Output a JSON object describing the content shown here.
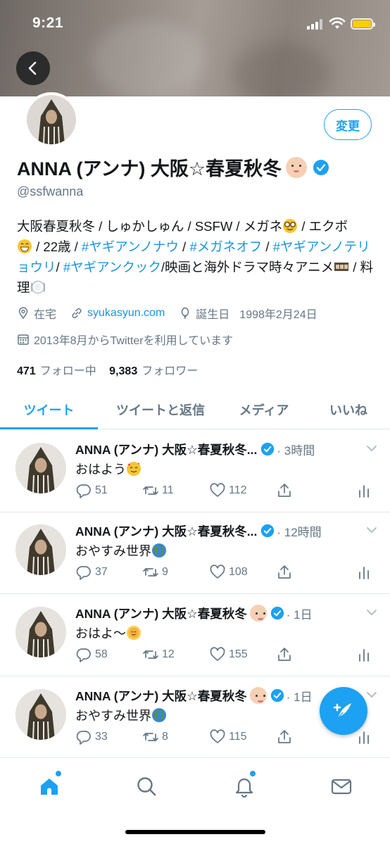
{
  "status_bar": {
    "time": "9:21"
  },
  "profile": {
    "edit_label": "変更",
    "display_name": "ANNA (アンナ) 大阪☆春夏秋冬",
    "handle": "@ssfwanna",
    "bio": {
      "part1": "大阪春夏秋冬 / しゅかしゅん / SSFW / メガネ",
      "part2": " / エクボ",
      "part3": " / 22歳 / ",
      "tag1": "#ヤギアンノナウ",
      "sep1": " / ",
      "tag2": "#メガネオフ",
      "sep2": " / ",
      "tag3": "#ヤギアンノテリョウリ",
      "sep3": "/ ",
      "tag4": "#ヤギアンクック",
      "part4": "/映画と海外ドラマ時々アニメ",
      "part5": " / 料理"
    },
    "location": "在宅",
    "website": "syukasyun.com",
    "birthday_label": "誕生日",
    "birthday": "1998年2月24日",
    "joined": "2013年8月からTwitterを利用しています",
    "following_count": "471",
    "following_label": "フォロー中",
    "followers_count": "9,383",
    "followers_label": "フォロワー"
  },
  "tabs": [
    {
      "label": "ツイート"
    },
    {
      "label": "ツイートと返信"
    },
    {
      "label": "メディア"
    },
    {
      "label": "いいね"
    }
  ],
  "tweets": [
    {
      "name": "ANNA (アンナ) 大阪☆春夏秋冬...",
      "time": "· 3時間",
      "text": "おはよう",
      "replies": "51",
      "retweets": "11",
      "likes": "112"
    },
    {
      "name": "ANNA (アンナ) 大阪☆春夏秋冬...",
      "time": "· 12時間",
      "text": "おやすみ世界",
      "replies": "37",
      "retweets": "9",
      "likes": "108"
    },
    {
      "name": "ANNA (アンナ) 大阪☆春夏秋冬",
      "time": "· 1日",
      "text": "おはよ〜",
      "replies": "58",
      "retweets": "12",
      "likes": "155"
    },
    {
      "name": "ANNA (アンナ) 大阪☆春夏秋冬",
      "time": "· 1日",
      "text": "おやすみ世界",
      "replies": "33",
      "retweets": "8",
      "likes": "115"
    }
  ],
  "icons": {
    "back": "back-arrow-icon",
    "compose": "compose-feather-icon",
    "nav": [
      "home-icon",
      "search-icon",
      "notifications-icon",
      "messages-icon"
    ]
  },
  "colors": {
    "accent": "#1da1f2",
    "link": "#1b95e0",
    "muted": "#657786"
  }
}
